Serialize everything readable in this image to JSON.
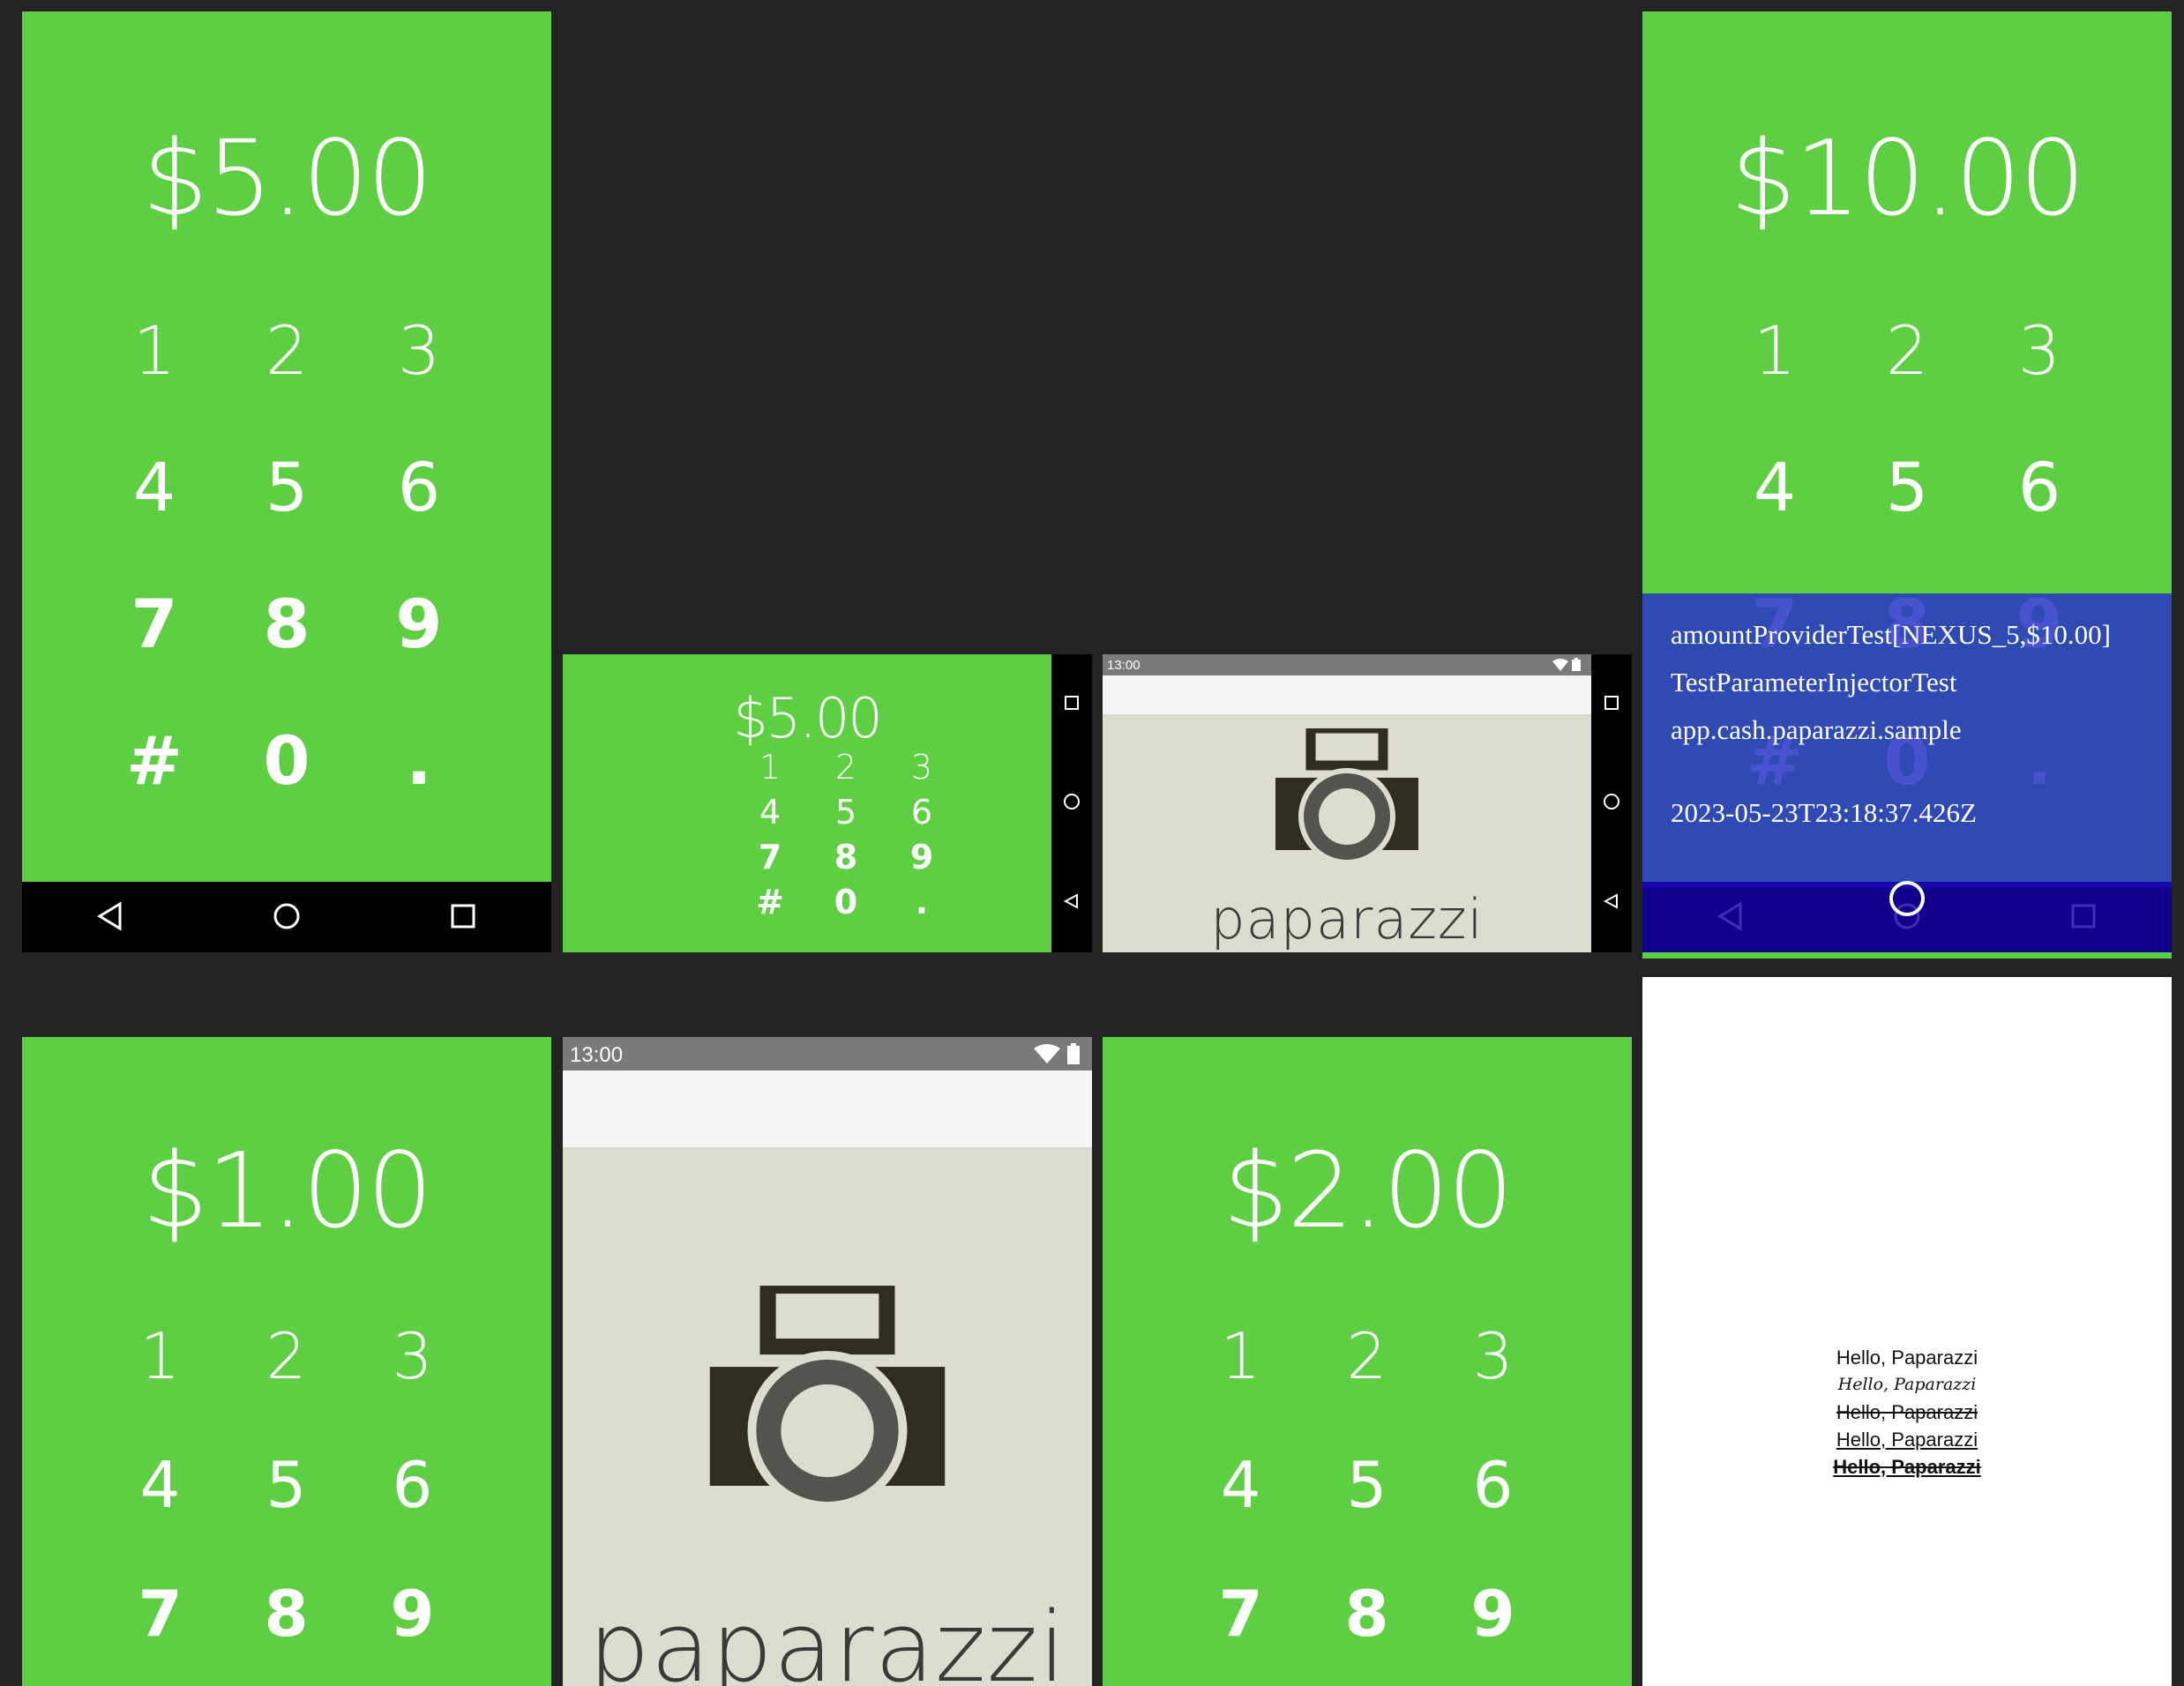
{
  "keypad": {
    "row1": [
      "1",
      "2",
      "3"
    ],
    "row2": [
      "4",
      "5",
      "6"
    ],
    "row3": [
      "7",
      "8",
      "9"
    ],
    "row4": [
      "#",
      "0",
      "."
    ]
  },
  "shots": {
    "s1": {
      "amount": "$5.00"
    },
    "s2": {
      "amount": "$5.00"
    },
    "s3": {
      "wordmark": "paparazzi",
      "time": "13:00"
    },
    "s4": {
      "amount": "$10.00",
      "overlay": {
        "test_name": "amountProviderTest[NEXUS_5,$10.00]",
        "class_name": "TestParameterInjectorTest",
        "package_name": "app.cash.paparazzi.sample",
        "timestamp": "2023-05-23T23:18:37.426Z"
      }
    },
    "s5": {
      "amount": "$1.00"
    },
    "s6": {
      "wordmark": "paparazzi",
      "time": "13:00"
    },
    "s7": {
      "amount": "$2.00"
    },
    "s8": {
      "lines": [
        "Hello, Paparazzi",
        "Hello, Paparazzi",
        "Hello, Paparazzi",
        "Hello, Paparazzi",
        "Hello, Paparazzi"
      ]
    }
  },
  "colors": {
    "keypad_green": "#5ecf43",
    "overlay_blue": "#2e40b8",
    "overlay_nav": "#0f0099",
    "gallery_bg": "#232323",
    "paparazzi_bg": "#dcdccf"
  },
  "icons": [
    "back-icon",
    "home-icon",
    "recents-icon",
    "wifi-icon",
    "battery-icon",
    "camera-icon"
  ]
}
